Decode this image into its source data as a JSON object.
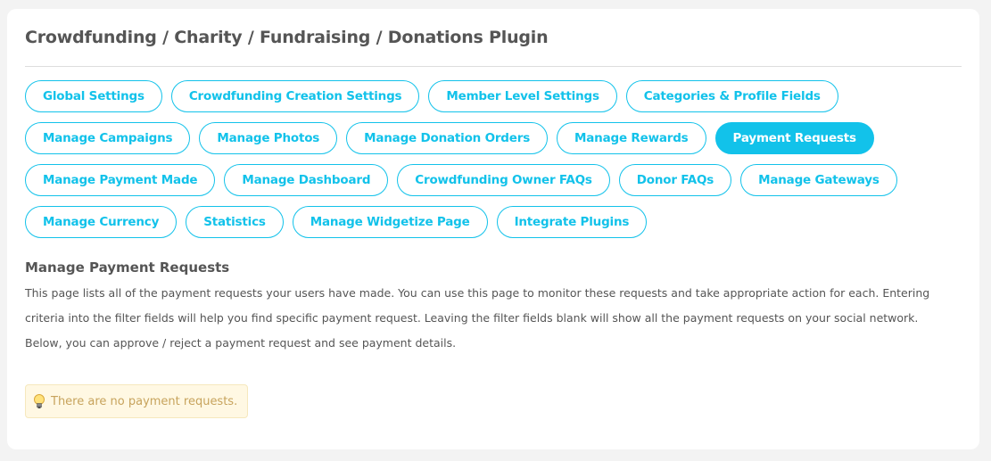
{
  "header": {
    "title": "Crowdfunding / Charity / Fundraising / Donations Plugin"
  },
  "tabs": [
    {
      "label": "Global Settings",
      "active": false
    },
    {
      "label": "Crowdfunding Creation Settings",
      "active": false
    },
    {
      "label": "Member Level Settings",
      "active": false
    },
    {
      "label": "Categories & Profile Fields",
      "active": false
    },
    {
      "label": "Manage Campaigns",
      "active": false
    },
    {
      "label": "Manage Photos",
      "active": false
    },
    {
      "label": "Manage Donation Orders",
      "active": false
    },
    {
      "label": "Manage Rewards",
      "active": false
    },
    {
      "label": "Payment Requests",
      "active": true
    },
    {
      "label": "Manage Payment Made",
      "active": false
    },
    {
      "label": "Manage Dashboard",
      "active": false
    },
    {
      "label": "Crowdfunding Owner FAQs",
      "active": false
    },
    {
      "label": "Donor FAQs",
      "active": false
    },
    {
      "label": "Manage Gateways",
      "active": false
    },
    {
      "label": "Manage Currency",
      "active": false
    },
    {
      "label": "Statistics",
      "active": false
    },
    {
      "label": "Manage Widgetize Page",
      "active": false
    },
    {
      "label": "Integrate Plugins",
      "active": false
    }
  ],
  "content": {
    "section_title": "Manage Payment Requests",
    "description_1": "This page lists all of the payment requests your users have made. You can use this page to monitor these requests and take appropriate action for each. Entering criteria into the filter fields will help you find specific payment request. Leaving the filter fields blank will show all the payment requests on your social network.",
    "description_2": "Below, you can approve / reject a payment request and see payment details.",
    "tip_icon": "lightbulb-icon",
    "tip_message": "There are no payment requests."
  },
  "colors": {
    "accent": "#12c2ea",
    "tip_background": "#fff8e3",
    "tip_text": "#c7a35c"
  }
}
